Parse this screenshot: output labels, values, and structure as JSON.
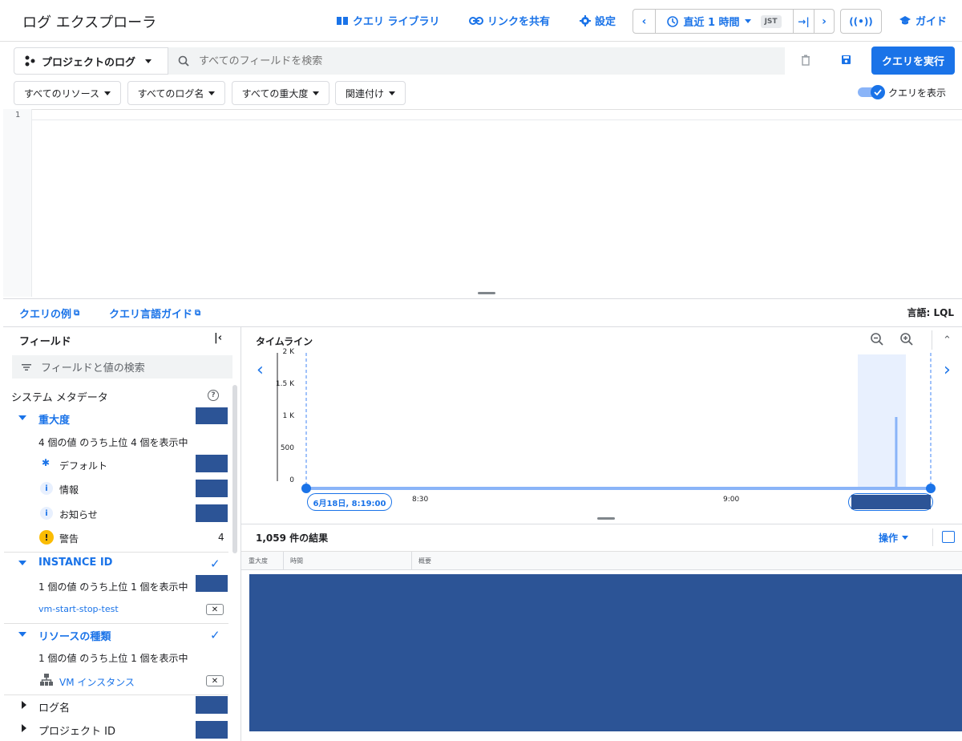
{
  "header": {
    "title": "ログ エクスプローラ",
    "query_library": "クエリ ライブラリ",
    "share_link": "リンクを共有",
    "settings": "設定",
    "time_range": "直近 1 時間",
    "timezone": "JST",
    "guide": "ガイド"
  },
  "search": {
    "scope": "プロジェクトのログ",
    "placeholder": "すべてのフィールドを検索",
    "run_label": "クエリを実行"
  },
  "filters": {
    "resources": "すべてのリソース",
    "log_names": "すべてのログ名",
    "severity": "すべての重大度",
    "correlate": "関連付け",
    "show_query": "クエリを表示",
    "show_query_on": true
  },
  "editor": {
    "line_number": "1"
  },
  "links": {
    "query_examples": "クエリの例",
    "query_language_guide": "クエリ言語ガイド",
    "language": "言語: LQL"
  },
  "fields": {
    "title": "フィールド",
    "search_placeholder": "フィールドと値の検索",
    "system_metadata": "システム メタデータ",
    "severity": {
      "label": "重大度",
      "summary": "4 個の値 のうち上位 4 個を表示中",
      "items": [
        {
          "label": "デフォルト",
          "icon": "asterisk-icon"
        },
        {
          "label": "情報",
          "icon": "info-icon"
        },
        {
          "label": "お知らせ",
          "icon": "info-icon"
        },
        {
          "label": "警告",
          "icon": "warning-icon",
          "count": "4"
        }
      ]
    },
    "instance_id": {
      "label": "INSTANCE ID",
      "summary": "1 個の値 のうち上位 1 個を表示中",
      "value": "vm-start-stop-test"
    },
    "resource_type": {
      "label": "リソースの種類",
      "summary": "1 個の値 のうち上位 1 個を表示中",
      "value": "VM インスタンス"
    },
    "log_name": "ログ名",
    "project_id": "プロジェクト ID"
  },
  "timeline": {
    "title": "タイムライン",
    "start_label": "6月18日, 8:19:00",
    "x_ticks": [
      "8:30",
      "9:00"
    ],
    "y_ticks": [
      "2 K",
      "1.5 K",
      "1 K",
      "500",
      "0"
    ]
  },
  "chart_data": {
    "type": "bar",
    "title": "タイムライン",
    "xlabel": "",
    "ylabel": "",
    "ylim": [
      0,
      2000
    ],
    "y_ticks": [
      0,
      500,
      1000,
      1500,
      2000
    ],
    "x_ticks": [
      "8:30",
      "9:00"
    ],
    "x": [
      "9:16"
    ],
    "values": [
      1100
    ]
  },
  "results": {
    "count": "1,059 件の結果",
    "actions": "操作",
    "columns": [
      "重大度",
      "時間",
      "概要"
    ]
  },
  "colors": {
    "accent": "#1a73e8",
    "redaction": "#2c5496",
    "warning": "#fbbc04"
  }
}
